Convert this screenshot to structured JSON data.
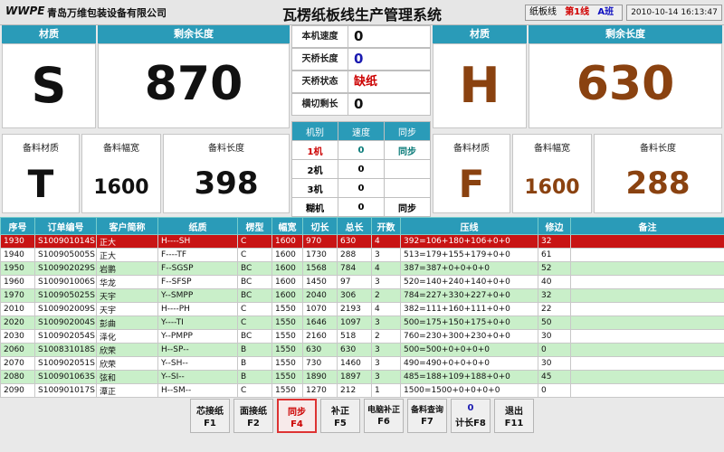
{
  "header": {
    "logo": "WWPE",
    "company": "青岛万维包装设备有限公司",
    "title": "瓦楞纸板线生产管理系统",
    "line_label": "纸板线",
    "line_num": "第1线",
    "shift": "A班",
    "datetime": "2010-10-14 16:13:47"
  },
  "left_panel": {
    "material_header": "材质",
    "remaining_header": "剩余长度",
    "material": "S",
    "remaining": "870",
    "prep_material_label": "备料材质",
    "prep_width_label": "备料幅宽",
    "prep_length_label": "备料长度",
    "prep_material": "T",
    "prep_width": "1600",
    "prep_length": "398"
  },
  "right_panel": {
    "material_header": "材质",
    "remaining_header": "剩余长度",
    "material": "H",
    "remaining": "630",
    "prep_material_label": "备料材质",
    "prep_width_label": "备料幅宽",
    "prep_length_label": "备料长度",
    "prep_material": "F",
    "prep_width": "1600",
    "prep_length": "288"
  },
  "status": {
    "speed_label": "本机速度",
    "speed": "0",
    "bridge_label": "天桥长度",
    "bridge": "0",
    "bridge_state_label": "天桥状态",
    "bridge_state": "缺纸",
    "cut_label": "横切剩长",
    "cut": "0"
  },
  "machines": {
    "headers": [
      "机别",
      "速度",
      "同步"
    ],
    "rows": [
      {
        "name": "1机",
        "speed": "0",
        "sync": "同步"
      },
      {
        "name": "2机",
        "speed": "0",
        "sync": ""
      },
      {
        "name": "3机",
        "speed": "0",
        "sync": ""
      },
      {
        "name": "糊机",
        "speed": "0",
        "sync": "同步"
      }
    ]
  },
  "orders": {
    "headers": [
      "序号",
      "订单编号",
      "客户简称",
      "纸质",
      "楞型",
      "幅宽",
      "切长",
      "总长",
      "开数",
      "压线",
      "修边",
      "备注"
    ],
    "rows": [
      [
        "1930",
        "S100901014S",
        "正大",
        "H----SH",
        "C",
        "1600",
        "970",
        "630",
        "4",
        "392=106+180+106+0+0",
        "32",
        ""
      ],
      [
        "1940",
        "S100905005S",
        "正大",
        "F----TF",
        "C",
        "1600",
        "1730",
        "288",
        "3",
        "513=179+155+179+0+0",
        "61",
        ""
      ],
      [
        "1950",
        "S100902029S",
        "岩鹏",
        "F--SGSP",
        "BC",
        "1600",
        "1568",
        "784",
        "4",
        "387=387+0+0+0+0",
        "52",
        ""
      ],
      [
        "1960",
        "S100901006S",
        "华龙",
        "F--SFSP",
        "BC",
        "1600",
        "1450",
        "97",
        "3",
        "520=140+240+140+0+0",
        "40",
        ""
      ],
      [
        "1970",
        "S100905025S",
        "天宇",
        "Y--SMPP",
        "BC",
        "1600",
        "2040",
        "306",
        "2",
        "784=227+330+227+0+0",
        "32",
        ""
      ],
      [
        "2010",
        "S100902009S",
        "天宇",
        "H----PH",
        "C",
        "1550",
        "1070",
        "2193",
        "4",
        "382=111+160+111+0+0",
        "22",
        ""
      ],
      [
        "2020",
        "S100902004S",
        "彭曲",
        "Y----TI",
        "C",
        "1550",
        "1646",
        "1097",
        "3",
        "500=175+150+175+0+0",
        "50",
        ""
      ],
      [
        "2030",
        "S100902054S",
        "泽化",
        "Y--PMPP",
        "BC",
        "1550",
        "2160",
        "518",
        "2",
        "760=230+300+230+0+0",
        "30",
        ""
      ],
      [
        "2060",
        "S100831018S",
        "欣荣",
        "H--SP--",
        "B",
        "1550",
        "630",
        "630",
        "3",
        "500=500+0+0+0+0",
        "0",
        ""
      ],
      [
        "2070",
        "S100902051S",
        "欣荣",
        "Y--SH--",
        "B",
        "1550",
        "730",
        "1460",
        "3",
        "490=490+0+0+0+0",
        "30",
        ""
      ],
      [
        "2080",
        "S100901063S",
        "弦和",
        "Y--SI--",
        "B",
        "1550",
        "1890",
        "1897",
        "3",
        "485=188+109+188+0+0",
        "45",
        ""
      ],
      [
        "2090",
        "S100901017S",
        "潭正",
        "H--SM--",
        "C",
        "1550",
        "1270",
        "212",
        "1",
        "1500=1500+0+0+0+0",
        "0",
        ""
      ]
    ]
  },
  "fkeys": [
    {
      "label": "芯接纸",
      "key": "F1"
    },
    {
      "label": "面接纸",
      "key": "F2"
    },
    {
      "label": "同步",
      "key": "F4"
    },
    {
      "label": "补正",
      "key": "F5"
    },
    {
      "label": "电脑补正",
      "key": "F6"
    },
    {
      "label": "备料查询",
      "key": "F7"
    },
    {
      "label": "0",
      "key": "计长F8"
    },
    {
      "label": "退出",
      "key": "F11"
    }
  ]
}
